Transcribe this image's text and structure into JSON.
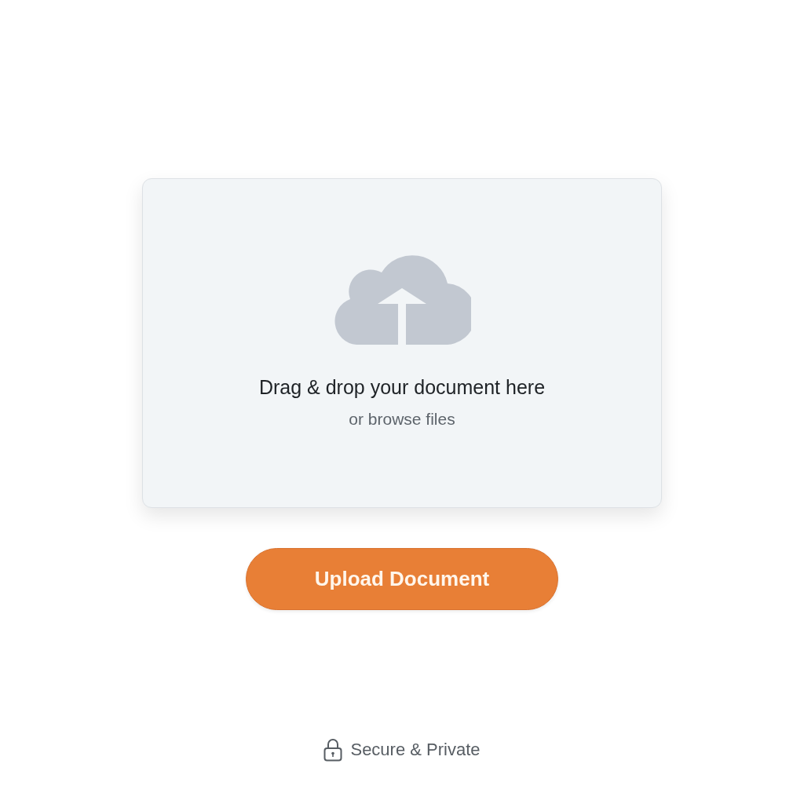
{
  "dropzone": {
    "title": "Drag & drop your document here",
    "subtitle": "or browse files"
  },
  "upload_button": {
    "label": "Upload Document"
  },
  "footer": {
    "label": "Secure & Private"
  }
}
